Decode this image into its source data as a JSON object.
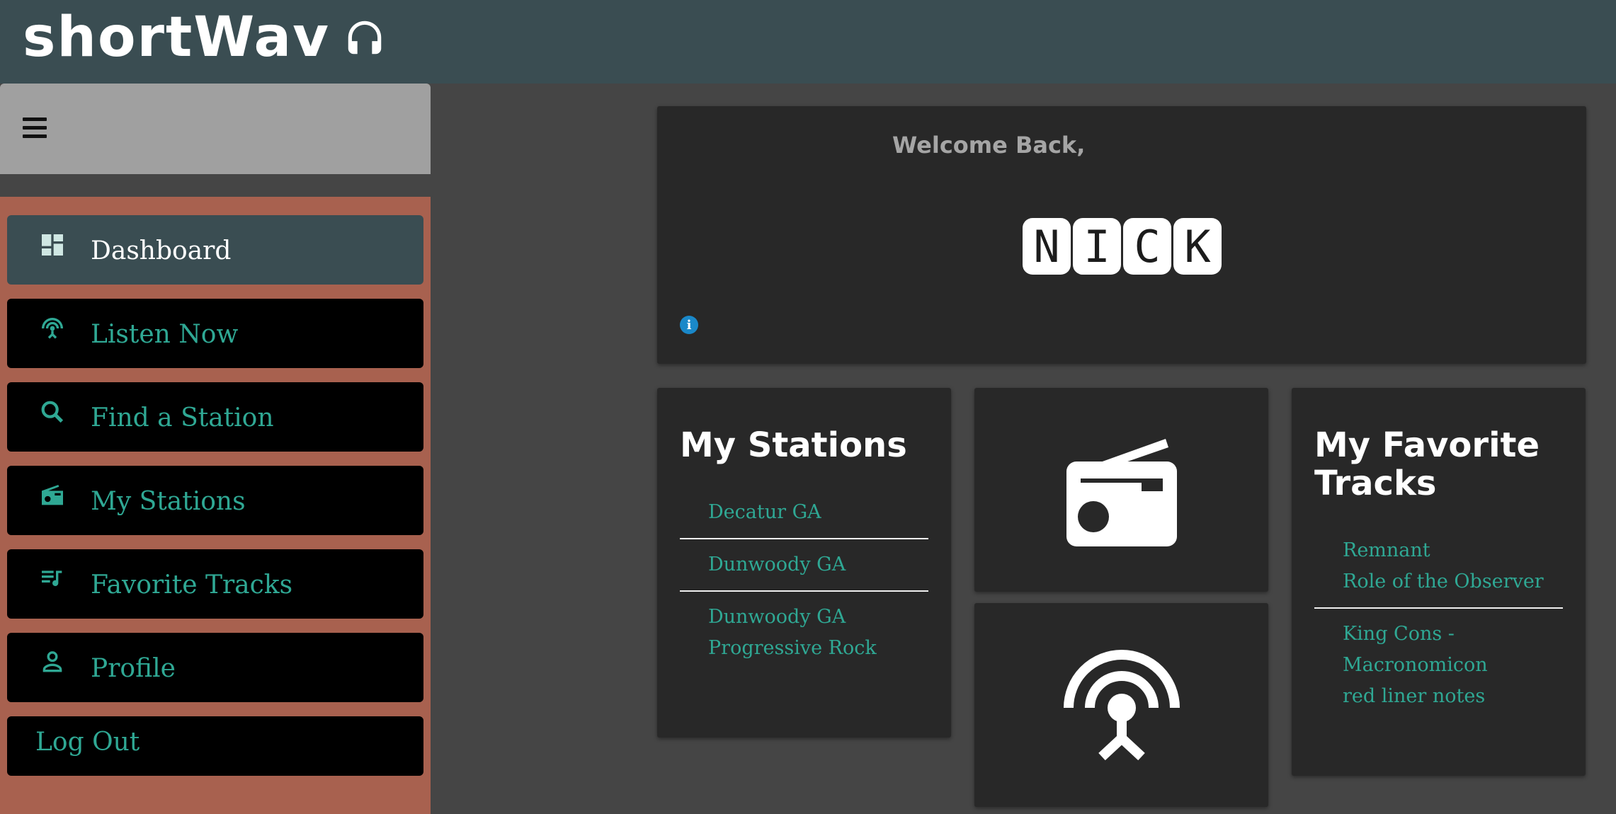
{
  "header": {
    "app_title": "shortWav",
    "logo_icon": "headphones-icon"
  },
  "sidebar": {
    "menu_icon": "hamburger-menu-icon",
    "items": [
      {
        "label": "Dashboard",
        "icon": "dashboard-icon",
        "active": true
      },
      {
        "label": "Listen Now",
        "icon": "podcast-antenna-icon"
      },
      {
        "label": "Find a Station",
        "icon": "search-icon"
      },
      {
        "label": "My Stations",
        "icon": "radio-icon"
      },
      {
        "label": "Favorite Tracks",
        "icon": "queue-music-icon"
      },
      {
        "label": "Profile",
        "icon": "person-icon"
      },
      {
        "label": "Log Out"
      }
    ]
  },
  "welcome": {
    "greeting": "Welcome Back,",
    "name_letters": [
      "N",
      "I",
      "C",
      "K"
    ],
    "info_icon": "info-icon"
  },
  "my_stations": {
    "title": "My Stations",
    "stations": [
      {
        "line1": "Decatur GA"
      },
      {
        "line1": "Dunwoody GA"
      },
      {
        "line1": "Dunwoody GA",
        "line2": "Progressive Rock"
      }
    ]
  },
  "favorite_tracks": {
    "title_line1": "My Favorite",
    "title_line2": "Tracks",
    "tracks": [
      {
        "line1": "Remnant",
        "line2": "Role of the Observer"
      },
      {
        "line1": "King Cons -",
        "line2": "Macronomicon",
        "line3": "red liner notes"
      }
    ]
  },
  "colors": {
    "topbar": "#3a4d52",
    "sidebar": "#a8614f",
    "accent_teal": "#2fa894",
    "card": "#282828",
    "info_blue": "#1a88c9"
  }
}
